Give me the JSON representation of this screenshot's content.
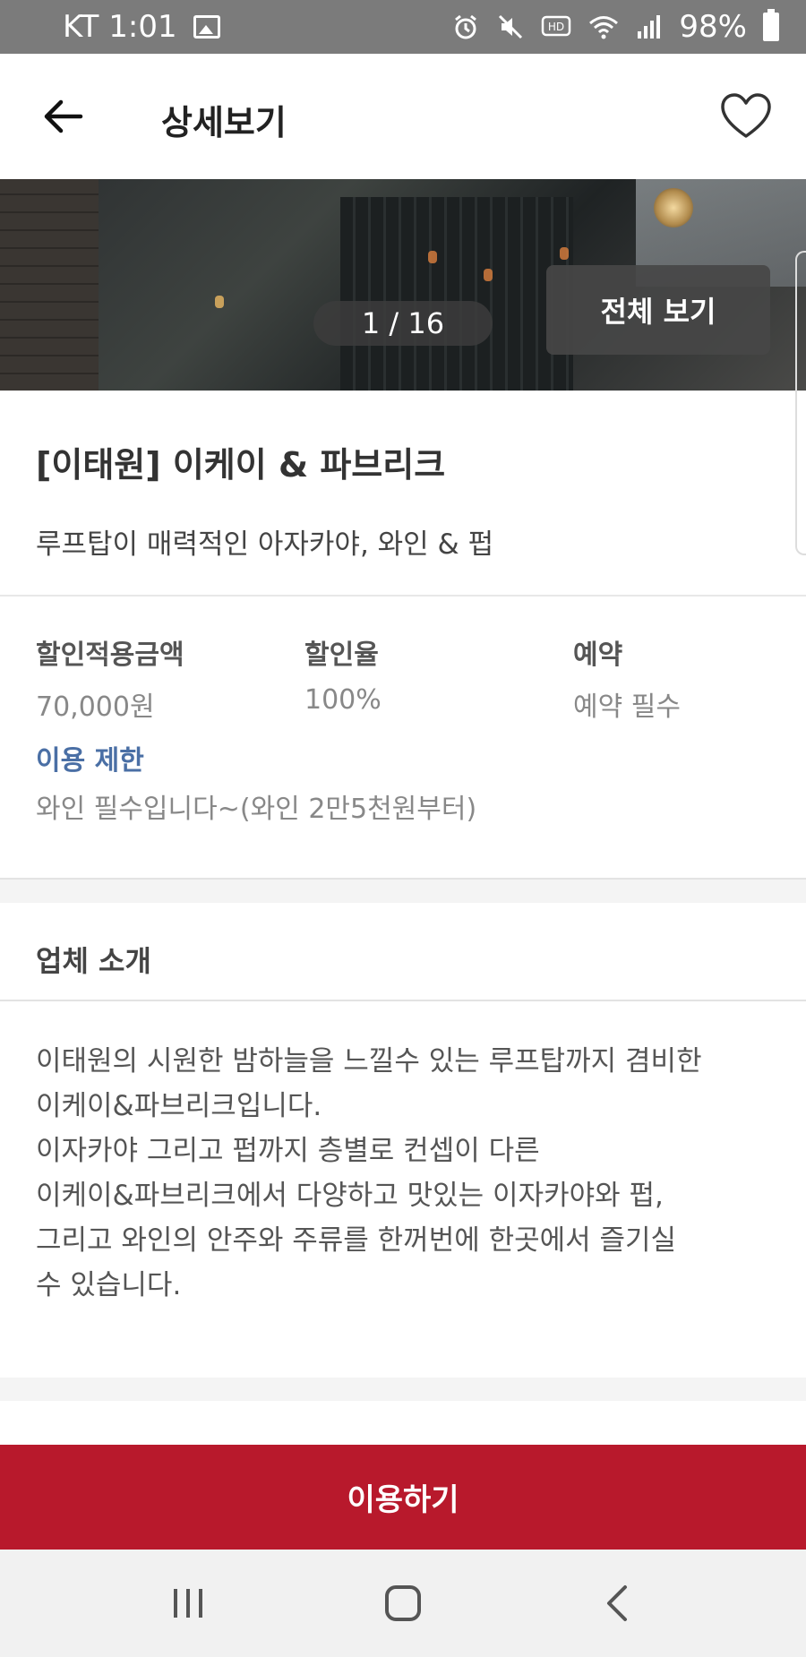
{
  "status_bar": {
    "carrier_time": "KT 1:01",
    "battery": "98%"
  },
  "header": {
    "title": "상세보기"
  },
  "gallery": {
    "counter": "1 / 16",
    "view_all_label": "전체 보기"
  },
  "shop": {
    "name": "[이태원] 이케이 & 파브리크",
    "description": "루프탑이 매력적인 아자카야, 와인 & 펍"
  },
  "info": {
    "discount_amount_label": "할인적용금액",
    "discount_amount_value": "70,000원",
    "discount_rate_label": "할인율",
    "discount_rate_value": "100%",
    "reservation_label": "예약",
    "reservation_value": "예약 필수",
    "limit_label": "이용 제한",
    "limit_value": "와인 필수입니다~(와인 2만5천원부터)"
  },
  "intro": {
    "title": "업체 소개",
    "lines": [
      "이태원의 시원한 밤하늘을 느낄수 있는 루프탑까지 겸비한",
      "이케이&파브리크입니다.",
      "이자카야 그리고 펍까지 층별로 컨셉이 다른",
      "이케이&파브리크에서 다양하고 맛있는 이자카야와 펍,",
      "그리고 와인의 안주와 주류를 한꺼번에 한곳에서 즐기실",
      "수 있습니다."
    ]
  },
  "cta": {
    "label": "이용하기"
  },
  "colors": {
    "cta_bg": "#b8192c",
    "limit_label": "#4a6fa5",
    "status_bar_bg": "#7b7b7b"
  },
  "icons": [
    "back-arrow-icon",
    "heart-icon",
    "image-icon",
    "alarm-icon",
    "mute-icon",
    "hd-icon",
    "wifi-icon",
    "signal-icon",
    "battery-icon",
    "recent-apps-icon",
    "home-icon",
    "nav-back-icon"
  ]
}
